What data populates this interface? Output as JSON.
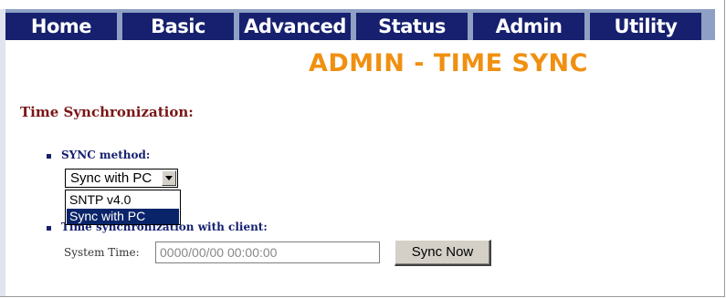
{
  "nav": {
    "items": [
      {
        "label": "Home"
      },
      {
        "label": "Basic"
      },
      {
        "label": "Advanced"
      },
      {
        "label": "Status"
      },
      {
        "label": "Admin"
      },
      {
        "label": "Utility"
      }
    ]
  },
  "page": {
    "title": "ADMIN - TIME SYNC",
    "section_heading": "Time Synchronization:"
  },
  "sync_method": {
    "label": "SYNC method:",
    "selected": "Sync with PC",
    "options": [
      "SNTP v4.0",
      "Sync with PC"
    ],
    "highlighted_option": "Sync with PC"
  },
  "time_sync": {
    "label": "Time synchronization with client:",
    "system_time_label": "System Time:",
    "system_time_value": "0000/00/00 00:00:00",
    "sync_button_label": "Sync Now"
  },
  "colors": {
    "nav_background": "#16206e",
    "nav_text": "#ffffff",
    "title": "#f09010",
    "section_heading": "#7a1515",
    "label": "#16206e",
    "selection_highlight": "#0a246a"
  },
  "icons": {
    "dropdown_arrow": "chevron-down-icon",
    "list_bullet": "square-bullet-icon"
  }
}
